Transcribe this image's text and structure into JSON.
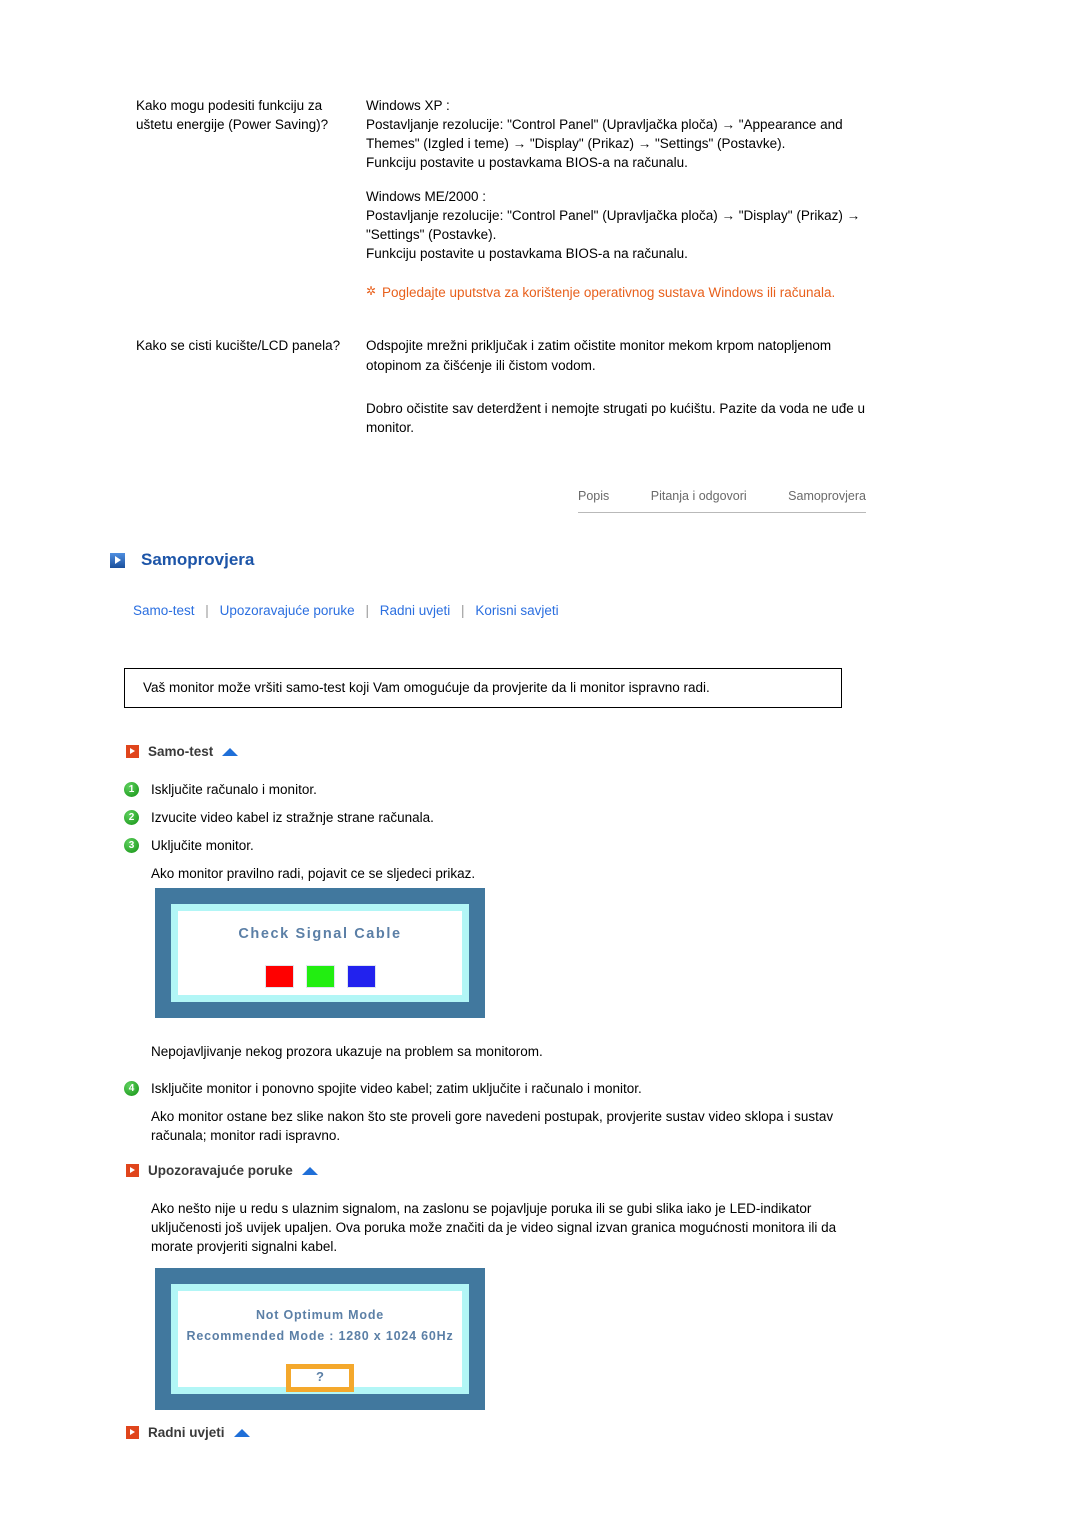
{
  "faq": {
    "rows": [
      {
        "question": "Kako mogu podesiti funkciju za uštetu energije (Power Saving)?",
        "answer_blocks": [
          "Windows XP :\nPostavljanje rezolucije: \"Control Panel\" (Upravljačka ploča) → \"Appearance and Themes\" (Izgled i teme) → \"Display\" (Prikaz) → \"Settings\" (Postavke).\nFunkciju postavite u postavkama BIOS-a na računalu.",
          "Windows ME/2000 :\nPostavljanje rezolucije: \"Control Panel\" (Upravljačka ploča) → \"Display\" (Prikaz) → \"Settings\" (Postavke).\nFunkciju postavite u postavkama BIOS-a na računalu."
        ],
        "note_icon": "asterisk-note-icon",
        "note": "Pogledajte uputstva za korištenje operativnog sustava Windows ili računala."
      },
      {
        "question": "Kako se cisti kucište/LCD panela?",
        "answer_blocks": [
          "Odspojite mrežni priključak i zatim očistite monitor mekom krpom natopljenom otopinom za čišćenje ili čistom vodom.",
          "Dobro očistite sav deterdžent i nemojte strugati po kućištu. Pazite da voda ne uđe u monitor."
        ]
      }
    ]
  },
  "tabnav": {
    "items": [
      "Popis",
      "Pitanja i odgovori",
      "Samoprovjera"
    ]
  },
  "main_heading": {
    "icon": "blue-play-square-icon",
    "title": "Samoprovjera",
    "color": "#1d55a8"
  },
  "link_row": {
    "separator": "|",
    "links": [
      "Samo-test",
      "Upozoravajuće poruke",
      "Radni uvjeti",
      "Korisni savjeti"
    ],
    "color": "#2b6fe0"
  },
  "intro_box": {
    "text": "Vaš monitor može vršiti samo-test koji Vam omogućuje da provjerite da li monitor ispravno radi."
  },
  "section_samotest": {
    "icon": "orange-play-square-icon",
    "title": "Samo-test",
    "top_arrow_icon": "up-arrow-icon",
    "steps": [
      {
        "num": "1",
        "text": "Isključite računalo i monitor."
      },
      {
        "num": "2",
        "text": "Izvucite video kabel iz stražnje strane računala."
      },
      {
        "num": "3",
        "text": "Uključite monitor."
      }
    ],
    "after_step3": "Ako monitor pravilno radi, pojavit ce se sljedeci prikaz.",
    "after_image": "Nepojavljivanje nekog prozora ukazuje na problem sa monitorom.",
    "step4": {
      "num": "4",
      "text": "Isključite monitor i ponovno spojite video kabel; zatim uključite i računalo i monitor."
    },
    "after_step4": "Ako monitor ostane bez slike nakon što ste proveli gore navedeni postupak, provjerite sustav video sklopa i sustav računala; monitor radi ispravno."
  },
  "monitor_signal": {
    "osd_text": "Check Signal Cable",
    "swatches": [
      "#ff0000",
      "#22ee11",
      "#2222ee"
    ],
    "bezel_color": "#41789e",
    "inner_frame_color": "#b2f6f6"
  },
  "section_upozoravajuce": {
    "icon": "orange-play-square-icon",
    "title": "Upozoravajuće poruke",
    "top_arrow_icon": "up-arrow-icon",
    "paragraph": "Ako nešto nije u redu s ulaznim signalom, na zaslonu se pojavljuje poruka ili se gubi slika iako je LED-indikator uključenosti još uvijek upaljen. Ova poruka može značiti da je video signal izvan granica mogućnosti monitora ili da morate provjeriti signalni kabel."
  },
  "monitor_notoptimum": {
    "osd_line1": "Not Optimum Mode",
    "osd_line2": "Recommended Mode : 1280 x 1024  60Hz",
    "question_mark": "?",
    "qbox_border_color": "#f4a82c"
  },
  "section_radni": {
    "icon": "orange-play-square-icon",
    "title": "Radni uvjeti",
    "top_arrow_icon": "up-arrow-icon"
  }
}
